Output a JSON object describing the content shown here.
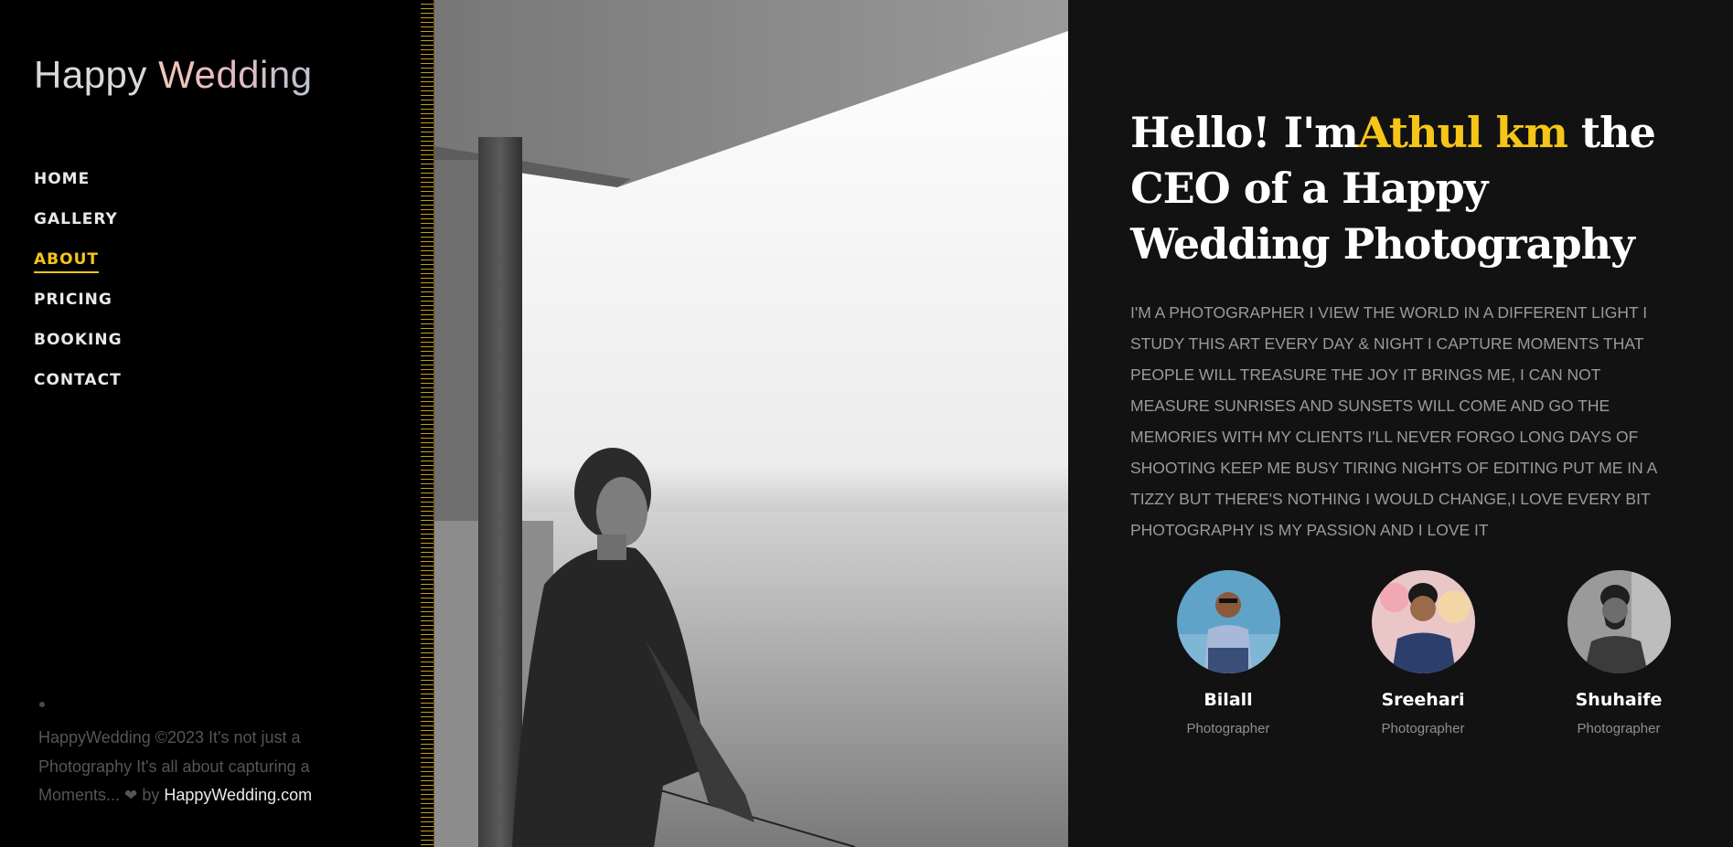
{
  "sidebar": {
    "logo": {
      "word1": "Happy",
      "word2": "Wedding"
    },
    "nav": [
      {
        "label": "HOME",
        "active": false
      },
      {
        "label": "GALLERY",
        "active": false
      },
      {
        "label": "ABOUT",
        "active": true
      },
      {
        "label": "PRICING",
        "active": false
      },
      {
        "label": "BOOKING",
        "active": false
      },
      {
        "label": "CONTACT",
        "active": false
      }
    ],
    "footer": {
      "text": "HappyWedding ©2023 It's not just a Photography It's all about capturing a Moments...",
      "heart_icon": "heart-icon",
      "by": "by",
      "link": "HappyWedding.com"
    }
  },
  "hero_photo": {
    "icon": "portrait-photo",
    "tone": "black-and-white"
  },
  "about": {
    "heading": {
      "prefix": "Hello! I'm",
      "name": "Athul km",
      "suffix": " the CEO of a Happy Wedding Photography"
    },
    "bio": "I'M A PHOTOGRAPHER I VIEW THE WORLD IN A DIFFERENT LIGHT I STUDY THIS ART EVERY DAY & NIGHT I CAPTURE MOMENTS THAT PEOPLE WILL TREASURE THE JOY IT BRINGS ME, I CAN NOT MEASURE SUNRISES AND SUNSETS WILL COME AND GO THE MEMORIES WITH MY CLIENTS I'LL NEVER FORGO LONG DAYS OF SHOOTING KEEP ME BUSY TIRING NIGHTS OF EDITING PUT ME IN A TIZZY BUT THERE'S NOTHING I WOULD CHANGE,I LOVE EVERY BIT PHOTOGRAPHY IS MY PASSION AND I LOVE IT"
  },
  "team": [
    {
      "name": "Bilall",
      "role": "Photographer"
    },
    {
      "name": "Sreehari",
      "role": "Photographer"
    },
    {
      "name": "Shuhaife",
      "role": "Photographer"
    }
  ],
  "colors": {
    "accent": "#f5c518",
    "background": "#000000",
    "content_bg": "#121212",
    "muted_text": "#9a9a9a"
  }
}
